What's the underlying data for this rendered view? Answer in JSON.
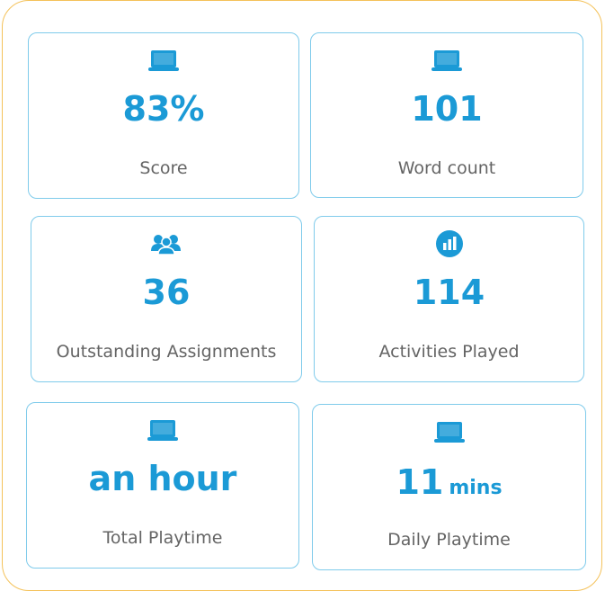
{
  "colors": {
    "accent": "#1b9ad6",
    "card_border": "#7fcbeb",
    "panel_border": "#f4c25a",
    "label": "#646464"
  },
  "stats": [
    {
      "icon": "laptop-icon",
      "value": "83%",
      "unit": "",
      "label": "Score"
    },
    {
      "icon": "laptop-icon",
      "value": "101",
      "unit": "",
      "label": "Word count"
    },
    {
      "icon": "users-icon",
      "value": "36",
      "unit": "",
      "label": "Outstanding Assignments"
    },
    {
      "icon": "bar-chart-icon",
      "value": "114",
      "unit": "",
      "label": "Activities Played"
    },
    {
      "icon": "laptop-icon",
      "value": "an hour",
      "unit": "",
      "label": "Total Playtime"
    },
    {
      "icon": "laptop-icon",
      "value": "11",
      "unit": "mins",
      "label": "Daily Playtime"
    }
  ]
}
